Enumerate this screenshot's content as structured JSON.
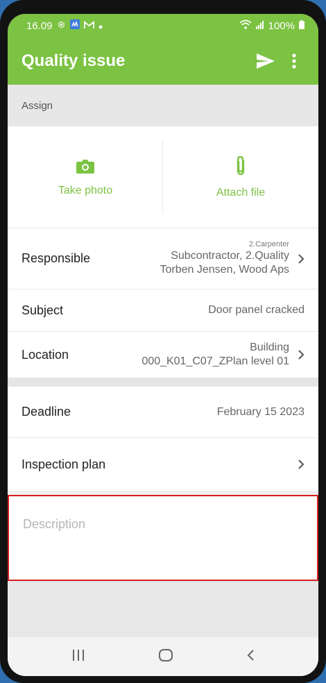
{
  "status_bar": {
    "time": "16.09",
    "battery": "100%"
  },
  "app_bar": {
    "title": "Quality issue",
    "send_icon": "send-icon",
    "more_icon": "more-vertical-icon"
  },
  "assign": {
    "label": "Assign"
  },
  "actions": {
    "take_photo": {
      "label": "Take photo",
      "icon": "camera-icon"
    },
    "attach_file": {
      "label": "Attach file",
      "icon": "paperclip-icon"
    }
  },
  "fields": {
    "responsible": {
      "label": "Responsible",
      "small": "2.Carpenter",
      "line1": "Subcontractor, 2.Quality",
      "line2": "Torben Jensen, Wood Aps"
    },
    "subject": {
      "label": "Subject",
      "value": "Door panel cracked"
    },
    "location": {
      "label": "Location",
      "line1": "Building",
      "line2": "000_K01_C07_ZPlan level 01"
    },
    "deadline": {
      "label": "Deadline",
      "value": "February 15 2023"
    },
    "inspection_plan": {
      "label": "Inspection plan"
    }
  },
  "description": {
    "placeholder": "Description"
  },
  "colors": {
    "accent": "#7cc243",
    "highlight": "#d81e1e"
  }
}
